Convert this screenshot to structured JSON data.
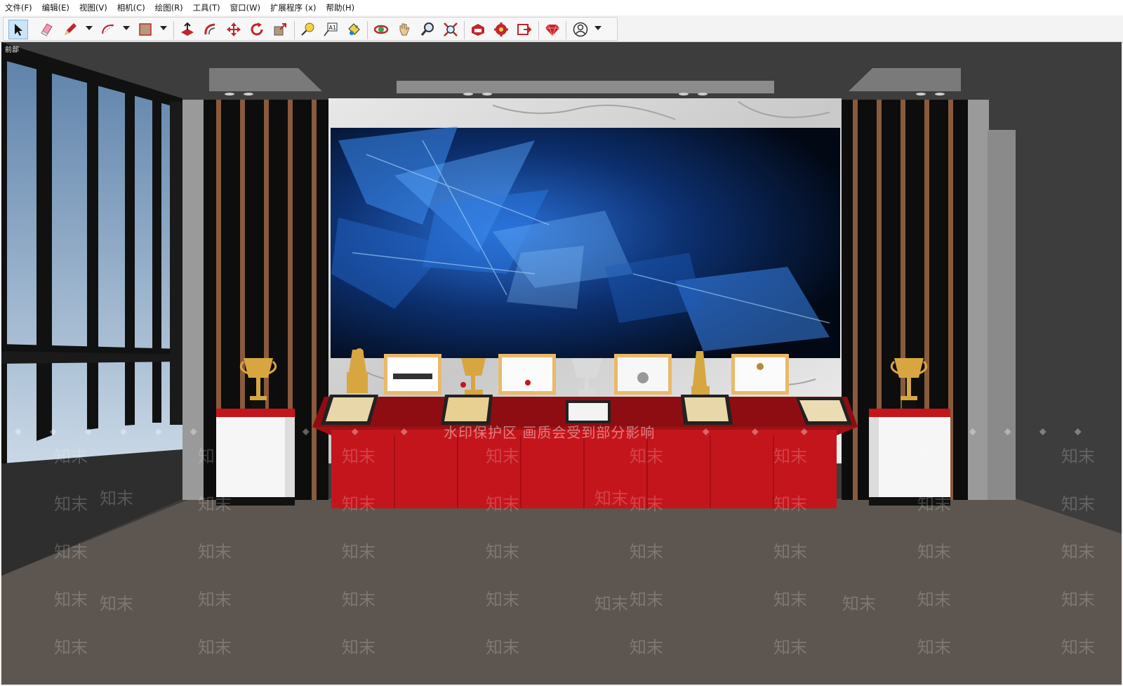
{
  "menu": [
    "文件(F)",
    "编辑(E)",
    "视图(V)",
    "相机(C)",
    "绘图(R)",
    "工具(T)",
    "窗口(W)",
    "扩展程序 (x)",
    "帮助(H)"
  ],
  "toolbar_icons": [
    "select-arrow-icon",
    "eraser-icon",
    "pencil-line-icon",
    "arc-icon",
    "rectangle-shape-icon",
    "push-pull-icon",
    "offset-icon",
    "move-icon",
    "rotate-icon",
    "scale-icon",
    "tape-measure-icon",
    "text-label-icon",
    "paint-bucket-icon",
    "orbit-icon",
    "pan-hand-icon",
    "zoom-icon",
    "zoom-extents-icon",
    "3d-warehouse-icon",
    "extension-warehouse-icon",
    "layout-send-icon",
    "ruby-console-icon",
    "user-account-icon"
  ],
  "viewport": {
    "scene_label": "前部",
    "watermark_notice": "水印保护区   画质会受到部分影响",
    "watermark_logo": "知末"
  },
  "colors": {
    "tablecloth_red": "#c5151c",
    "screen_blue": "#1e6bd8",
    "wood_strip": "#8a5a3c",
    "floor": "#5d554f",
    "trophy_gold": "#d8a640"
  }
}
